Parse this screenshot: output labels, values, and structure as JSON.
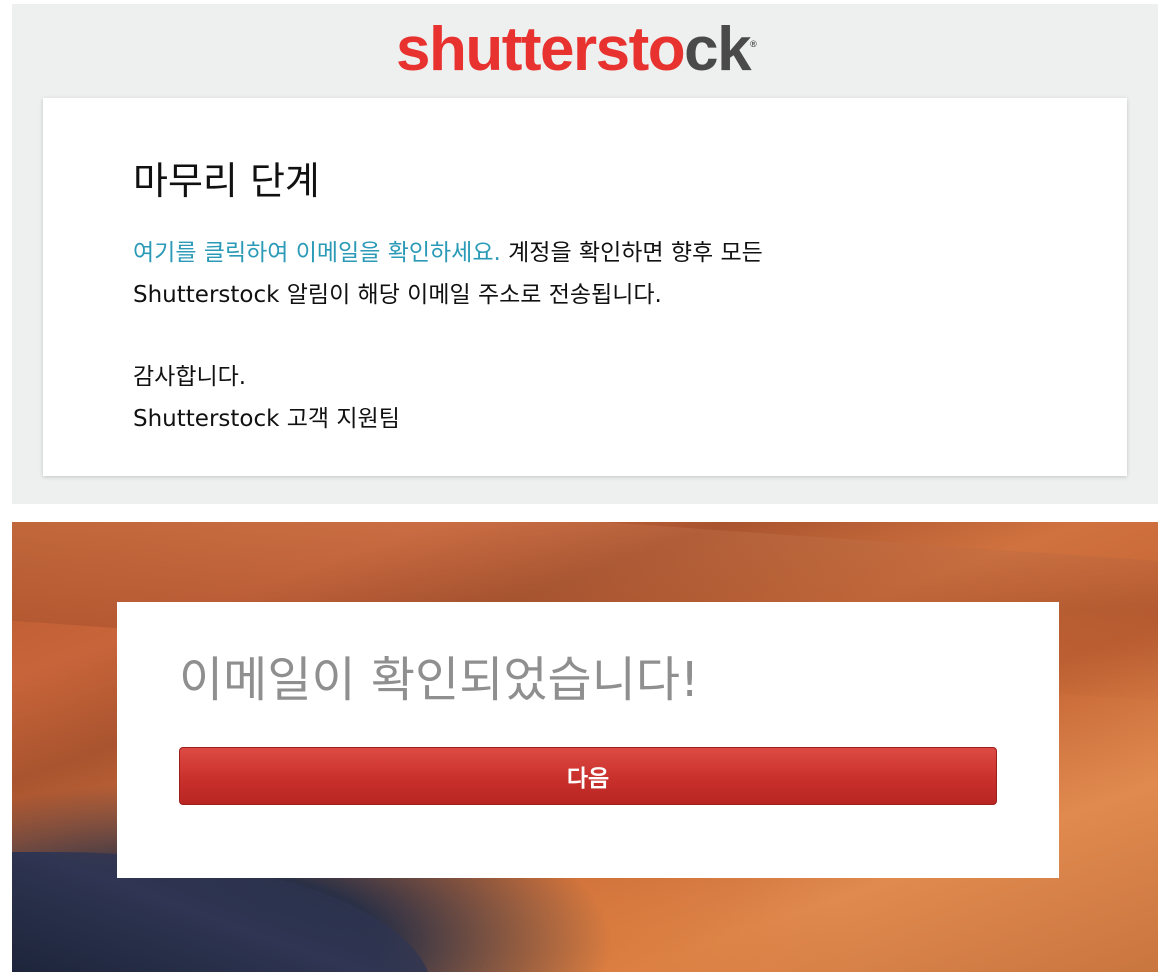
{
  "email": {
    "logo": {
      "part_red": "shutterst",
      "part_mid": "o",
      "part_dark": "ck",
      "reg_mark": "®"
    },
    "title": "마무리 단계",
    "link_text": "여기를 클릭하여 이메일을 확인하세요.",
    "body_text_1": " 계정을 확인하면 향후 모든",
    "body_text_2": "Shutterstock 알림이 해당 이메일 주소로 전송됩니다.",
    "sign_line_1": "감사합니다.",
    "sign_line_2": "Shutterstock 고객 지원팀"
  },
  "confirmation": {
    "title": "이메일이 확인되었습니다!",
    "next_button_label": "다음"
  },
  "colors": {
    "brand_red": "#e8322f",
    "logo_dark": "#4a4a4a",
    "link_blue": "#2a9ab7",
    "button_red": "#c9302c"
  }
}
